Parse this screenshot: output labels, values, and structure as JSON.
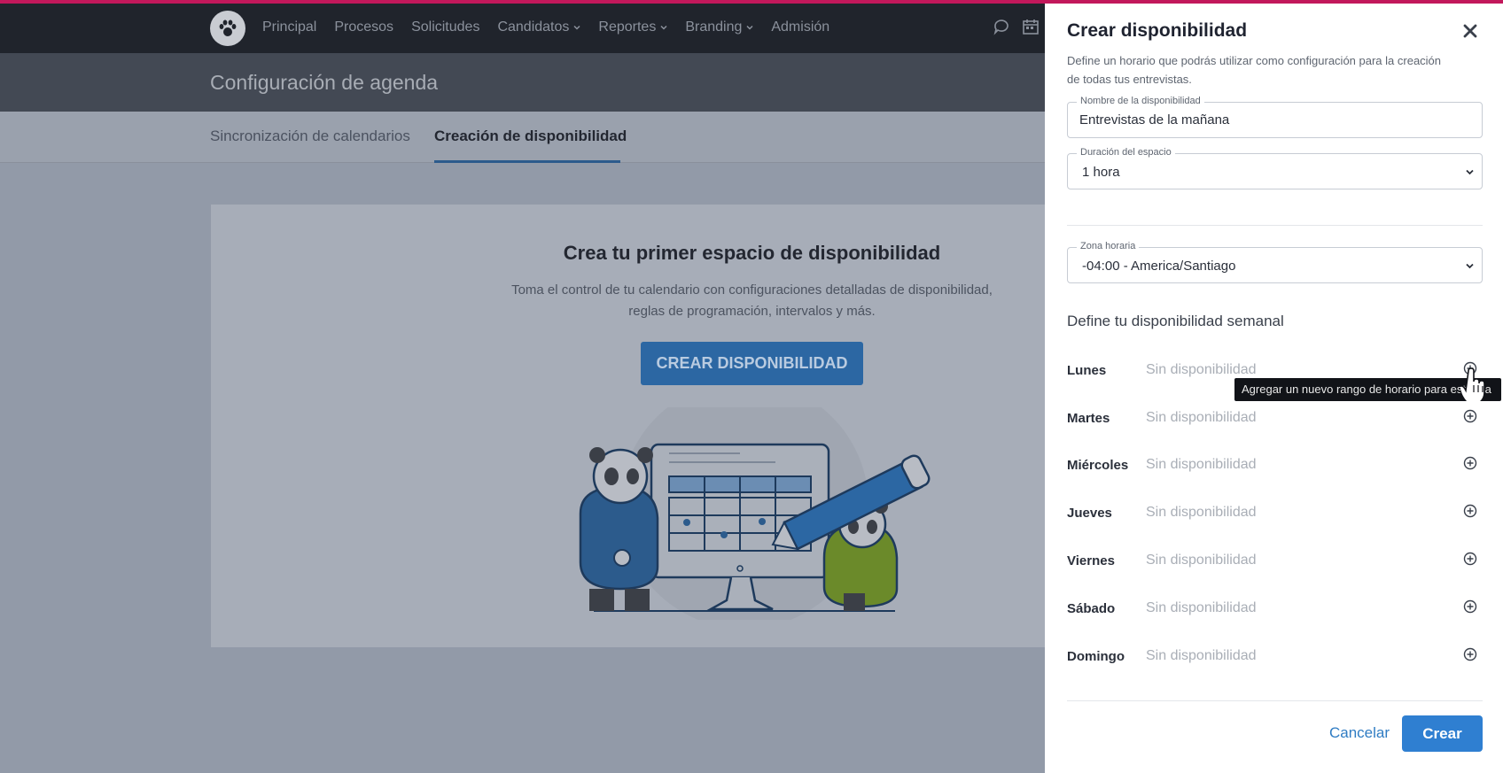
{
  "app": {
    "nav": {
      "items": [
        {
          "label": "Principal",
          "dropdown": false
        },
        {
          "label": "Procesos",
          "dropdown": false
        },
        {
          "label": "Solicitudes",
          "dropdown": false
        },
        {
          "label": "Candidatos",
          "dropdown": true
        },
        {
          "label": "Reportes",
          "dropdown": true
        },
        {
          "label": "Branding",
          "dropdown": true
        },
        {
          "label": "Admisión",
          "dropdown": false
        }
      ],
      "right_icons": [
        "chat-icon",
        "calendar-icon"
      ]
    },
    "page_title": "Configuración de agenda",
    "tabs": [
      {
        "label": "Sincronización de calendarios",
        "active": false
      },
      {
        "label": "Creación de disponibilidad",
        "active": true
      }
    ],
    "empty_state": {
      "title": "Crea tu primer espacio de disponibilidad",
      "description_line1": "Toma el control de tu calendario con configuraciones detalladas de disponibilidad,",
      "description_line2": "reglas de programación, intervalos y más.",
      "button_label": "CREAR DISPONIBILIDAD"
    }
  },
  "drawer": {
    "title": "Crear disponibilidad",
    "description": "Define un horario que podrás utilizar como configuración para la creación de todas tus entrevistas.",
    "name_field": {
      "label": "Nombre de la disponibilidad",
      "value": "Entrevistas de la mañana"
    },
    "duration_field": {
      "label": "Duración del espacio",
      "value": "1 hora"
    },
    "timezone_field": {
      "label": "Zona horaria",
      "value": "-04:00 - America/Santiago"
    },
    "weekly_heading": "Define tu disponibilidad semanal",
    "days": [
      {
        "name": "Lunes",
        "status": "Sin disponibilidad"
      },
      {
        "name": "Martes",
        "status": "Sin disponibilidad"
      },
      {
        "name": "Miércoles",
        "status": "Sin disponibilidad"
      },
      {
        "name": "Jueves",
        "status": "Sin disponibilidad"
      },
      {
        "name": "Viernes",
        "status": "Sin disponibilidad"
      },
      {
        "name": "Sábado",
        "status": "Sin disponibilidad"
      },
      {
        "name": "Domingo",
        "status": "Sin disponibilidad"
      }
    ],
    "tooltip": "Agregar un nuevo rango de horario para este día",
    "cancel_label": "Cancelar",
    "create_label": "Crear"
  },
  "colors": {
    "overlay_bg": "#929aa8",
    "navbar": "#20242c",
    "accent_pink": "#c2185b",
    "primary_button": "#2f7fd1",
    "link": "#2f7cc3"
  }
}
